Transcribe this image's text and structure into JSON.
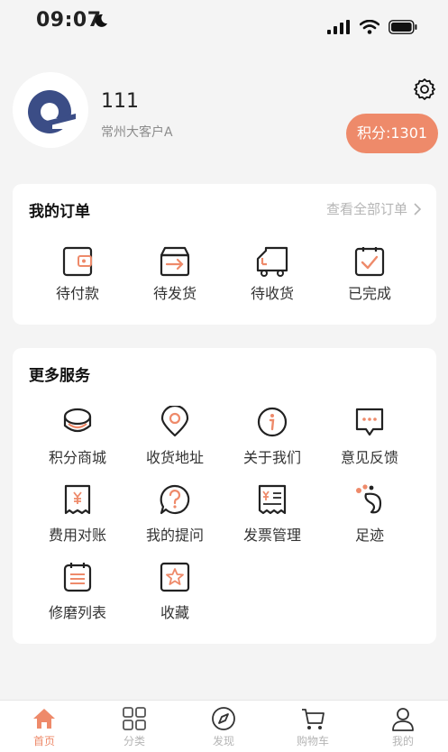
{
  "status_bar": {
    "time": "09:07"
  },
  "profile": {
    "username": "111",
    "user_type": "常州大客户A",
    "points": "积分:1301"
  },
  "orders": {
    "title": "我的订单",
    "view_all": "查看全部订单",
    "items": [
      {
        "label": "待付款",
        "icon": "wallet-icon"
      },
      {
        "label": "待发货",
        "icon": "box-ship-icon"
      },
      {
        "label": "待收货",
        "icon": "truck-icon"
      },
      {
        "label": "已完成",
        "icon": "check-clipboard-icon"
      }
    ]
  },
  "services": {
    "title": "更多服务",
    "items": [
      {
        "label": "积分商城",
        "icon": "coins-icon"
      },
      {
        "label": "收货地址",
        "icon": "location-pin-icon"
      },
      {
        "label": "关于我们",
        "icon": "info-icon"
      },
      {
        "label": "意见反馈",
        "icon": "chat-bubble-icon"
      },
      {
        "label": "费用对账",
        "icon": "receipt-icon"
      },
      {
        "label": "我的提问",
        "icon": "question-bubble-icon"
      },
      {
        "label": "发票管理",
        "icon": "invoice-icon"
      },
      {
        "label": "足迹",
        "icon": "footprint-icon"
      },
      {
        "label": "修磨列表",
        "icon": "calendar-list-icon"
      },
      {
        "label": "收藏",
        "icon": "star-box-icon"
      }
    ]
  },
  "tabbar": {
    "items": [
      {
        "label": "首页",
        "icon": "home-icon",
        "active": true
      },
      {
        "label": "分类",
        "icon": "grid-icon"
      },
      {
        "label": "发现",
        "icon": "compass-icon"
      },
      {
        "label": "购物车",
        "icon": "cart-icon"
      },
      {
        "label": "我的",
        "icon": "user-icon"
      }
    ]
  },
  "colors": {
    "accent": "#ee8a6a",
    "logo_blue": "#3b4d86",
    "background": "#f4f4f4"
  }
}
